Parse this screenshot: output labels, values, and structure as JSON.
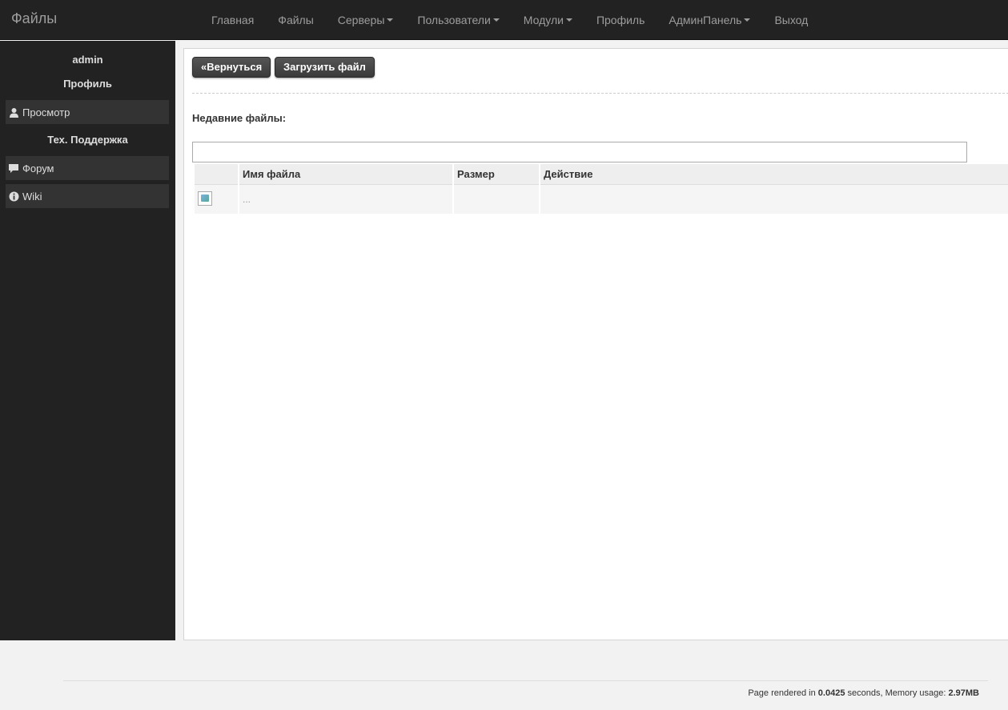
{
  "navbar": {
    "brand": "Файлы",
    "items": [
      {
        "label": "Главная",
        "dropdown": false
      },
      {
        "label": "Файлы",
        "dropdown": false
      },
      {
        "label": "Серверы",
        "dropdown": true
      },
      {
        "label": "Пользователи",
        "dropdown": true
      },
      {
        "label": "Модули",
        "dropdown": true
      },
      {
        "label": "Профиль",
        "dropdown": false
      },
      {
        "label": "АдминПанель",
        "dropdown": true
      },
      {
        "label": "Выход",
        "dropdown": false
      }
    ]
  },
  "sidebar": {
    "username": "admin",
    "profile_header": "Профиль",
    "view_item": "Просмотр",
    "support_header": "Тех. Поддержка",
    "forum_item": "Форум",
    "wiki_item": "Wiki"
  },
  "main": {
    "back_button": "«Вернуться",
    "upload_button": "Загрузить файл",
    "recent_label": "Недавние файлы:",
    "search_value": "",
    "table": {
      "headers": [
        "",
        "Имя файла",
        "Размер",
        "Действие"
      ],
      "rows": [
        {
          "icon": "broken-image-icon",
          "name": "...",
          "size": "",
          "action": ""
        }
      ]
    }
  },
  "footer": {
    "prefix": "Page rendered in ",
    "time": "0.0425",
    "middle": " seconds, Memory usage: ",
    "memory": "2.97MB"
  },
  "colors": {
    "navbar_bg": "#222222",
    "sidebar_bg": "#222222",
    "button_bg": "#3a3a3a"
  }
}
